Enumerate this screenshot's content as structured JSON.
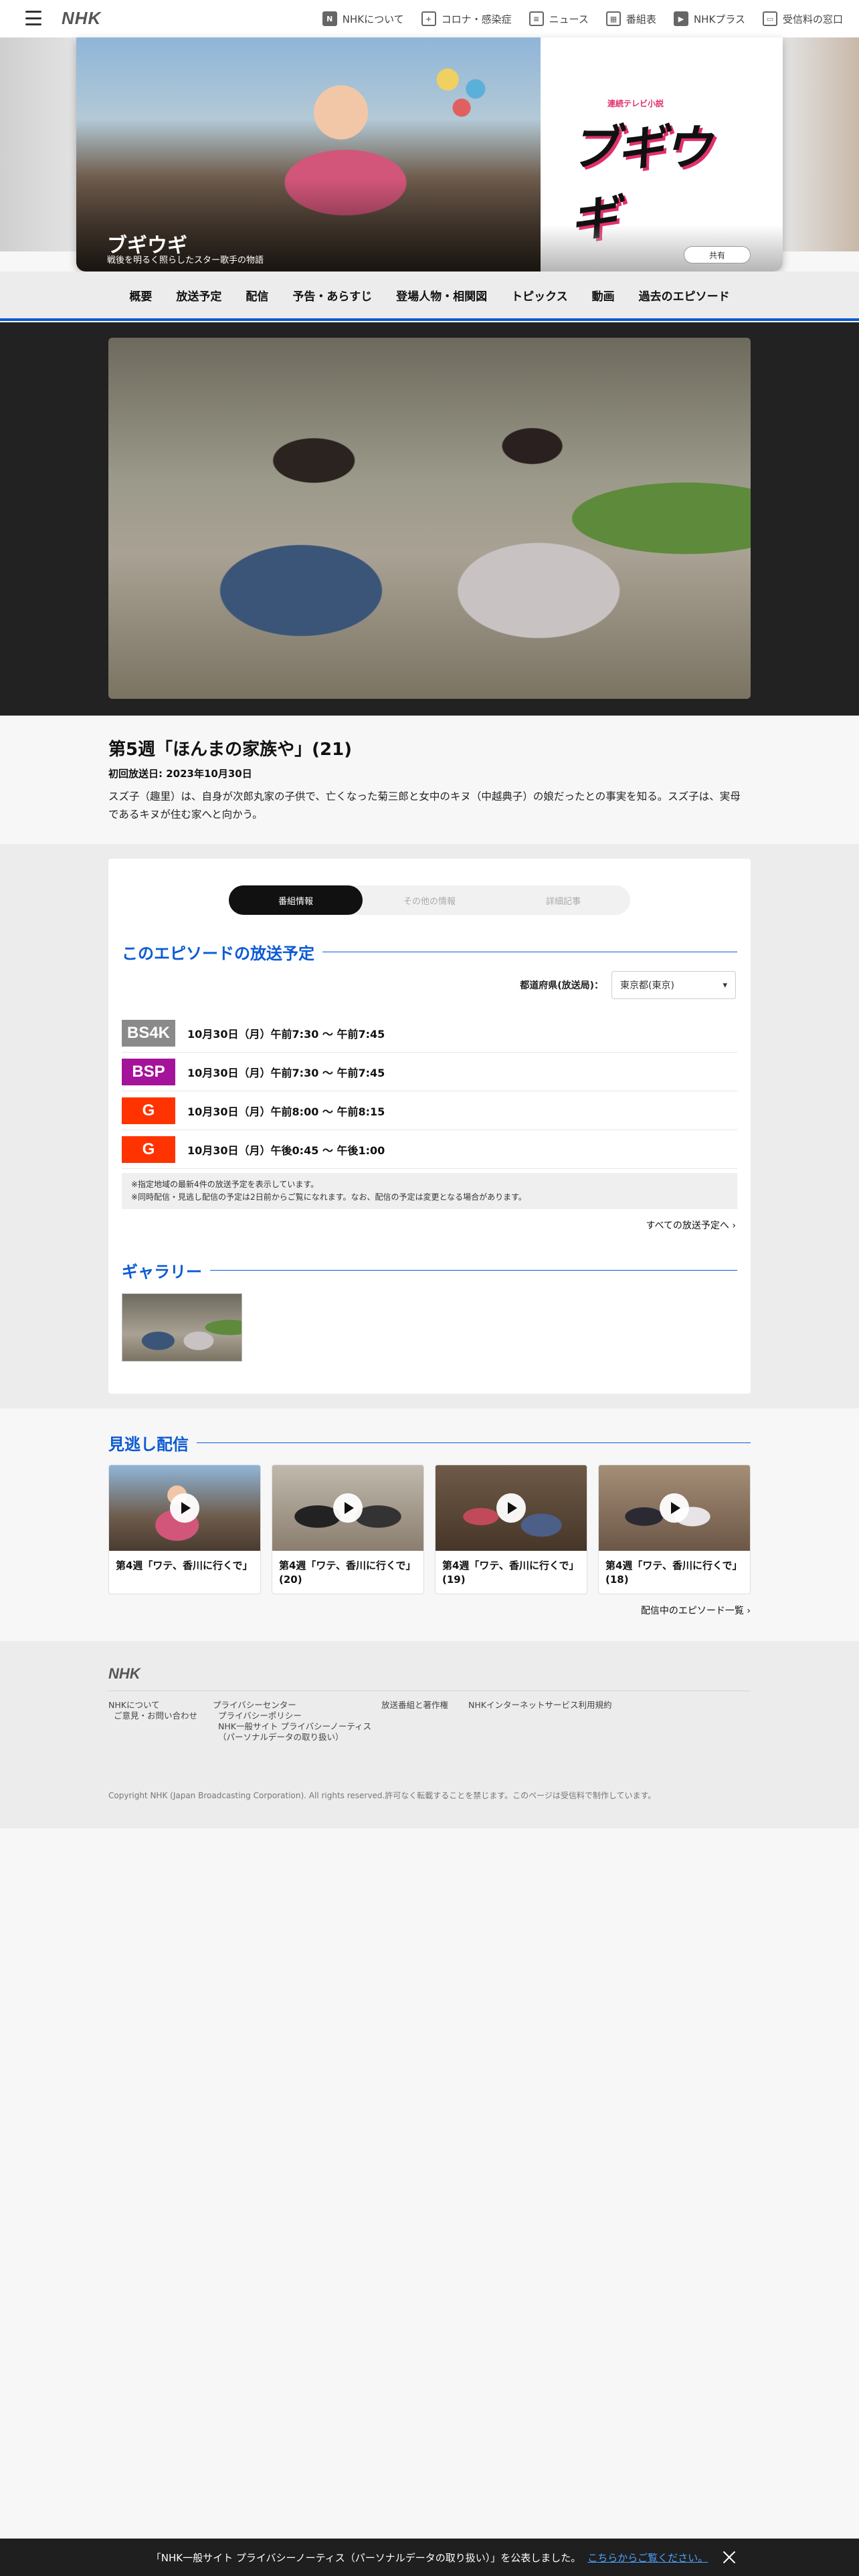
{
  "header": {
    "logo": "NHK",
    "nav": [
      {
        "label": "NHKについて",
        "icon": "nhk-icon"
      },
      {
        "label": "コロナ・感染症",
        "icon": "news-icon"
      },
      {
        "label": "ニュース",
        "icon": "newspaper-icon"
      },
      {
        "label": "番組表",
        "icon": "schedule-icon"
      },
      {
        "label": "NHKプラス",
        "icon": "plus-icon"
      },
      {
        "label": "受信料の窓口",
        "icon": "tv-icon"
      }
    ]
  },
  "hero": {
    "title": "ブギウギ",
    "subtitle": "戦後を明るく照らしたスター歌手の物語",
    "logo_small": "連続テレビ小説",
    "logo_big": "ブギウギ",
    "share_label": "共有"
  },
  "program_nav": [
    "概要",
    "放送予定",
    "配信",
    "予告・あらすじ",
    "登場人物・相関図",
    "トピックス",
    "動画",
    "過去のエピソード"
  ],
  "episode": {
    "title": "第5週「ほんまの家族や」(21)",
    "first_air": "初回放送日: 2023年10月30日",
    "description": "スズ子（趣里）は、自身が次郎丸家の子供で、亡くなった菊三郎と女中のキヌ（中越典子）の娘だったとの事実を知る。スズ子は、実母であるキヌが住む家へと向かう。"
  },
  "tabs": [
    "番組情報",
    "その他の情報",
    "詳細記事"
  ],
  "schedule": {
    "heading": "このエピソードの放送予定",
    "region_label": "都道府県(放送局)：",
    "region_value": "東京都(東京)",
    "rows": [
      {
        "channel": "BS4K",
        "color": "#8a8a8a",
        "time": "10月30日（月）午前7:30 〜 午前7:45"
      },
      {
        "channel": "BSP",
        "color": "#a5139b",
        "time": "10月30日（月）午前7:30 〜 午前7:45"
      },
      {
        "channel": "G",
        "color": "#ff3300",
        "time": "10月30日（月）午前8:00 〜 午前8:15"
      },
      {
        "channel": "G",
        "color": "#ff3300",
        "time": "10月30日（月）午後0:45 〜 午後1:00"
      }
    ],
    "notes": [
      "※指定地域の最新4件の放送予定を表示しています。",
      "※同時配信・見逃し配信の予定は2日前からご覧になれます。なお、配信の予定は変更となる場合があります。"
    ],
    "all_link": "すべての放送予定へ"
  },
  "gallery": {
    "heading": "ギャラリー"
  },
  "missed": {
    "heading": "見逃し配信",
    "items": [
      {
        "title": "第4週「ワテ、香川に行くで」"
      },
      {
        "title": "第4週「ワテ、香川に行くで」(20)"
      },
      {
        "title": "第4週「ワテ、香川に行くで」(19)"
      },
      {
        "title": "第4週「ワテ、香川に行くで」(18)"
      }
    ],
    "all_link": "配信中のエピソード一覧"
  },
  "footer": {
    "logo": "NHK",
    "col1": [
      "NHKについて",
      "ご意見・お問い合わせ"
    ],
    "col2": [
      "プライバシーセンター",
      "プライバシーポリシー",
      "NHK一般サイト プライバシーノーティス",
      "（パーソナルデータの取り扱い）"
    ],
    "col3": [
      "放送番組と著作権"
    ],
    "col4": [
      "NHKインターネットサービス利用規約"
    ],
    "copyright": "Copyright NHK (Japan Broadcasting Corporation). All rights reserved.許可なく転載することを禁じます。このページは受信料で制作しています。"
  },
  "privacy_bar": {
    "message": "「NHK一般サイト プライバシーノーティス（パーソナルデータの取り扱い）」を公表しました。",
    "link": "こちらからご覧ください。"
  }
}
